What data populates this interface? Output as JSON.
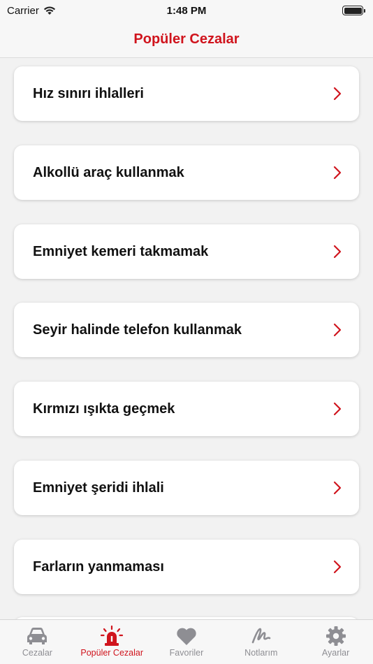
{
  "status": {
    "carrier": "Carrier",
    "time": "1:48 PM"
  },
  "nav": {
    "title": "Popüler Cezalar"
  },
  "items": [
    {
      "label": "Hız sınırı ihlalleri"
    },
    {
      "label": "Alkollü araç kullanmak"
    },
    {
      "label": "Emniyet kemeri takmamak"
    },
    {
      "label": "Seyir halinde telefon kullanmak"
    },
    {
      "label": "Kırmızı ışıkta geçmek"
    },
    {
      "label": "Emniyet şeridi ihlali"
    },
    {
      "label": "Farların yanmaması"
    }
  ],
  "tabs": [
    {
      "label": "Cezalar",
      "icon": "car-icon",
      "active": false
    },
    {
      "label": "Popüler Cezalar",
      "icon": "siren-icon",
      "active": true
    },
    {
      "label": "Favoriler",
      "icon": "heart-icon",
      "active": false
    },
    {
      "label": "Notlarım",
      "icon": "scribble-icon",
      "active": false
    },
    {
      "label": "Ayarlar",
      "icon": "gear-icon",
      "active": false
    }
  ],
  "colors": {
    "accent": "#d0141d",
    "inactive": "#8e8e93"
  }
}
